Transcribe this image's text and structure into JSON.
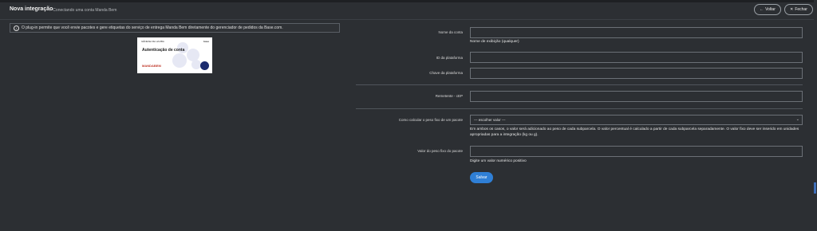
{
  "header": {
    "title": "Nova integração",
    "breadcrumb": "> Conectando uma conta Manda Bem",
    "back_label": "Voltar",
    "back_icon": "arrow-left-icon",
    "close_label": "Fechar",
    "close_icon": "close-icon"
  },
  "info": {
    "icon": "info-icon",
    "text": "O plug-in permite que você envie pacotes e gere etiquetas do serviço de entrega Manda Bem diretamente do gerenciador de pedidos da Base.com."
  },
  "preview": {
    "small_header_left": "GÊNESE DE HAJIBA",
    "small_header_right": "base",
    "heading": "Autenticação de conta",
    "logo_text": "MANDABEM"
  },
  "form": {
    "account_name_label": "Nome da conta",
    "account_name_help": "Nome de exibição (qualquer)",
    "platform_id_label": "ID da plataforma",
    "platform_key_label": "Chave da plataforma",
    "sender_zip_label": "Remetente - cEP",
    "fixed_weight_method_label": "Como calcular o peso fixo de um pacote",
    "fixed_weight_method_value": "--- escolher valor ---",
    "fixed_weight_method_help": "Em ambos os casos, o valor será adicionado ao peso de cada subparcela. O valor percentual é calculado a partir de cada subparcela separadamente. O valor fixo deve ser inserido em unidades apropriadas para a integração (kg ou g).",
    "fixed_weight_value_label": "Valor do peso fixo do pacote",
    "fixed_weight_value_help": "Digite um valor numérico positivo",
    "save_label": "Salvar"
  }
}
